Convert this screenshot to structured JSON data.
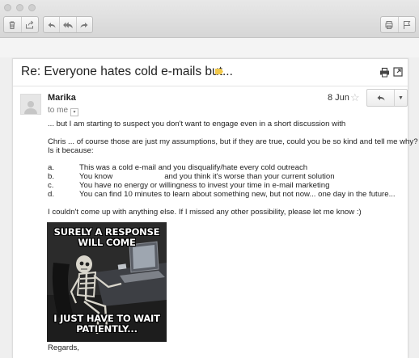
{
  "toolbar": {
    "left_group_icons": [
      "trash-icon",
      "move-icon"
    ],
    "reply_group_icons": [
      "reply-icon",
      "reply-all-icon",
      "forward-icon"
    ],
    "right_group_icons": [
      "print-icon",
      "flag-icon"
    ]
  },
  "email": {
    "subject": "Re: Everyone hates cold e-mails but...",
    "tag_color": "#f2c94c",
    "sender": "Marika",
    "date": "8 Jun",
    "to": "to me",
    "intro": "... but I am starting to suspect you don't want to engage even in a short discussion with",
    "para1_line1": "Chris ... of course those are just my assumptions, but if they are true, could you be so kind and tell me why?",
    "para1_line2": "Is it because:",
    "list": [
      {
        "letter": "a.",
        "text": "This was a cold e-mail and you disqualify/hate every cold outreach"
      },
      {
        "letter": "b.",
        "text": "You know                        and you think it's worse than your current solution"
      },
      {
        "letter": "c.",
        "text": "You have no energy or willingness to invest your time in e-mail marketing"
      },
      {
        "letter": "d.",
        "text": "You can find 10 minutes to learn about something new, but not now... one day in the future..."
      }
    ],
    "closing_line": "I couldn't come up with anything else. If I missed any other possibility, please let me know :)",
    "meme_top": "SURELY A RESPONSE WILL COME",
    "meme_bottom": "I JUST HAVE TO WAIT PATIENTLY...",
    "signoff": "Regards,"
  }
}
